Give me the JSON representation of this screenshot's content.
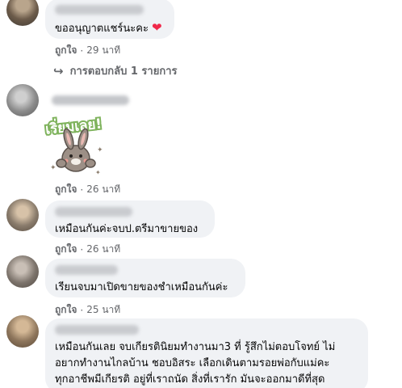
{
  "comments": [
    {
      "text": "ขออนุญาตแชร์นะคะ",
      "heart": "❤",
      "like": "ถูกใจ",
      "sep": "·",
      "time": "29 นาที",
      "reply_label": "การตอบกลับ 1 รายการ",
      "reply_icon": "reply-arrow-icon"
    },
    {
      "sticker_text": "เริ่ยมเลย!",
      "like": "ถูกใจ",
      "sep": "·",
      "time": "26 นาที"
    },
    {
      "text": "เหมือนกันค่ะจบป.ตรีมาขายของ",
      "like": "ถูกใจ",
      "sep": "·",
      "time": "26 นาที"
    },
    {
      "text": "เรียนจบมาเปิดขายของชำเหมือนกันค่ะ",
      "like": "ถูกใจ",
      "sep": "·",
      "time": "25 นาที"
    },
    {
      "lines": [
        "เหมือนกันเลย จบเกียรตินิยมทำงานมา3 ที่ รู้สึกไม่ตอบโจทย์ ไม่",
        "อยากทำงานไกลบ้าน ชอบอิสระ เลือกเดินตามรอยพ่อกับแม่คะ",
        "ทุกอาชีพมีเกียรติ อยู่ที่เราถนัด สิ่งที่เรารัก มันจะออกมาดีที่สุด"
      ]
    }
  ],
  "colors": {
    "bubble": "#f0f2f5",
    "meta": "#65676b",
    "heart": "#f02849"
  }
}
